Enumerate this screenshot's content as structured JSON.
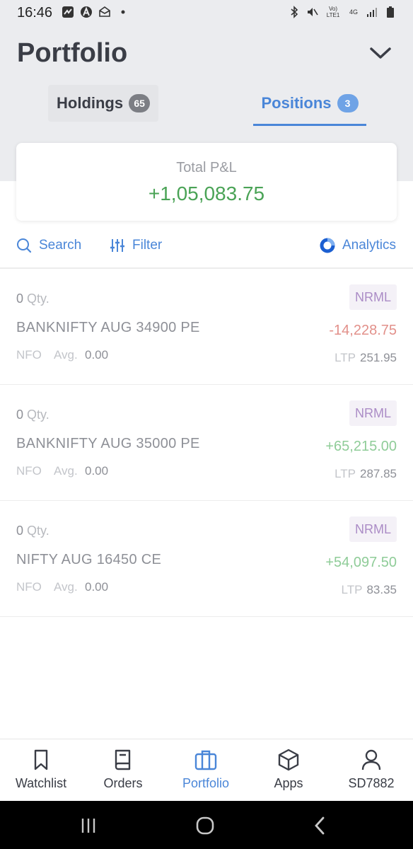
{
  "status_bar": {
    "time": "16:46",
    "left_icons": [
      "activity-icon",
      "a-circle-icon",
      "mail-icon",
      "dot-icon"
    ],
    "right_icons": [
      "bluetooth-icon",
      "mute-icon",
      "volte-icon",
      "4g-icon",
      "signal-icon",
      "battery-icon"
    ],
    "volte_text": "Vo) LTE1",
    "network_text": "4G"
  },
  "header": {
    "title": "Portfolio",
    "collapse_icon": "chevron-down-icon"
  },
  "tabs": [
    {
      "label": "Holdings",
      "count": "65",
      "active": false
    },
    {
      "label": "Positions",
      "count": "3",
      "active": true
    }
  ],
  "summary": {
    "label": "Total P&L",
    "value": "+1,05,083.75",
    "value_color": "#4aa356"
  },
  "toolbar": {
    "search_label": "Search",
    "filter_label": "Filter",
    "analytics_label": "Analytics"
  },
  "positions": [
    {
      "qty": "0",
      "qty_label": "Qty.",
      "product": "NRML",
      "instrument": "BANKNIFTY AUG 34900 PE",
      "pnl": "-14,228.75",
      "pnl_sign": "negative",
      "exchange": "NFO",
      "avg_label": "Avg.",
      "avg": "0.00",
      "ltp_label": "LTP",
      "ltp": "251.95"
    },
    {
      "qty": "0",
      "qty_label": "Qty.",
      "product": "NRML",
      "instrument": "BANKNIFTY AUG 35000 PE",
      "pnl": "+65,215.00",
      "pnl_sign": "positive",
      "exchange": "NFO",
      "avg_label": "Avg.",
      "avg": "0.00",
      "ltp_label": "LTP",
      "ltp": "287.85"
    },
    {
      "qty": "0",
      "qty_label": "Qty.",
      "product": "NRML",
      "instrument": "NIFTY AUG 16450 CE",
      "pnl": "+54,097.50",
      "pnl_sign": "positive",
      "exchange": "NFO",
      "avg_label": "Avg.",
      "avg": "0.00",
      "ltp_label": "LTP",
      "ltp": "83.35"
    }
  ],
  "bottom_nav": [
    {
      "label": "Watchlist",
      "icon": "bookmark-icon",
      "active": false
    },
    {
      "label": "Orders",
      "icon": "book-icon",
      "active": false
    },
    {
      "label": "Portfolio",
      "icon": "briefcase-icon",
      "active": true
    },
    {
      "label": "Apps",
      "icon": "cube-icon",
      "active": false
    },
    {
      "label": "SD7882",
      "icon": "user-icon",
      "active": false
    }
  ],
  "system_nav": [
    "recents-icon",
    "home-icon",
    "back-icon"
  ],
  "colors": {
    "accent": "#4a86d8",
    "profit": "#4aa356",
    "loss": "#e2908a",
    "product_badge": "#ab8cc6"
  }
}
